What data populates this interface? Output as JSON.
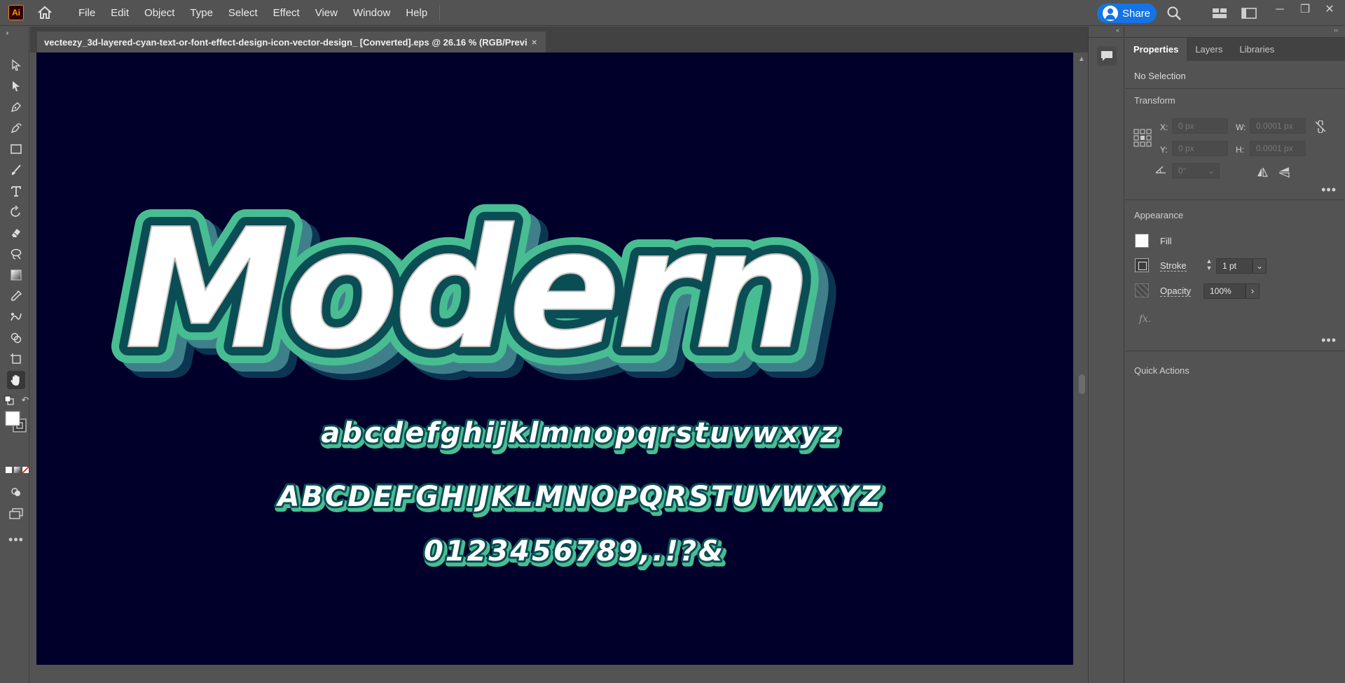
{
  "app": {
    "logo_text": "Ai"
  },
  "menu": {
    "items": [
      "File",
      "Edit",
      "Object",
      "Type",
      "Select",
      "Effect",
      "View",
      "Window",
      "Help"
    ]
  },
  "share": {
    "label": "Share"
  },
  "document": {
    "tab_title": "vecteezy_3d-layered-cyan-text-or-font-effect-design-icon-vector-design_ [Converted].eps @ 26.16 % (RGB/Previ",
    "close_glyph": "×"
  },
  "artwork": {
    "headline": "Modern",
    "lowercase": "abcdefghijklmnopqrstuvwxyz",
    "uppercase": "ABCDEFGHIJKLMNOPQRSTUVWXYZ",
    "numerals": "0123456789,.!?&",
    "colors": {
      "background": "#00002a",
      "face": "#ffffff",
      "inner_outline": "#0a4d55",
      "mid_layer": "#48bd92",
      "shadow_layer": "#3f7f8a",
      "deep_shadow": "#0c3552"
    }
  },
  "panel": {
    "tabs": [
      "Properties",
      "Layers",
      "Libraries"
    ],
    "active_tab": "Properties",
    "selection_status": "No Selection",
    "transform": {
      "title": "Transform",
      "x_label": "X:",
      "x_value": "0 px",
      "y_label": "Y:",
      "y_value": "0 px",
      "w_label": "W:",
      "w_value": "0.0001 px",
      "h_label": "H:",
      "h_value": "0.0001 px",
      "angle_value": "0°"
    },
    "appearance": {
      "title": "Appearance",
      "fill_label": "Fill",
      "stroke_label": "Stroke",
      "stroke_value": "1 pt",
      "opacity_label": "Opacity",
      "opacity_value": "100%",
      "fx_label": "fx."
    },
    "quick_actions": {
      "title": "Quick Actions"
    }
  }
}
